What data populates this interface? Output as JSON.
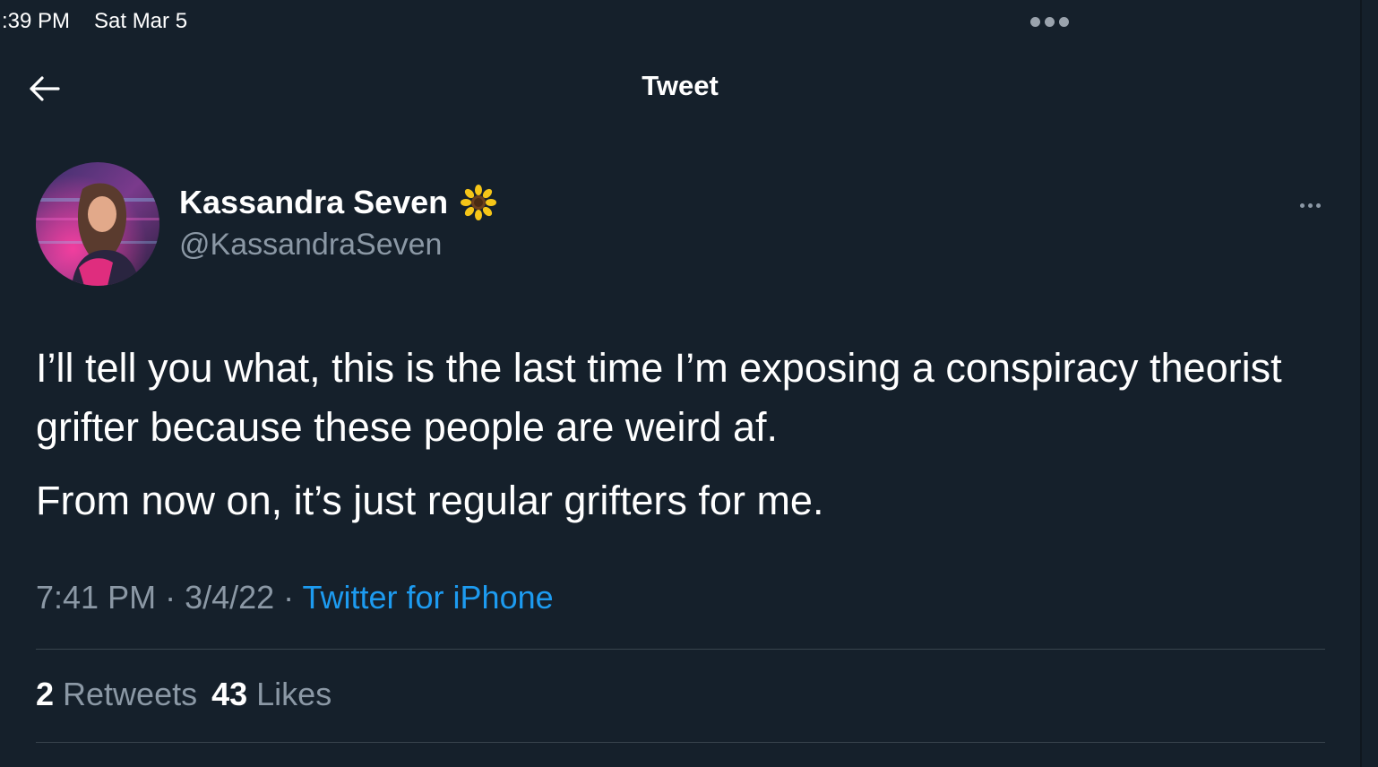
{
  "status_bar": {
    "time": ":39 PM",
    "date": "Sat Mar 5",
    "multitask_icon": "ellipsis-icon"
  },
  "header": {
    "title": "Tweet",
    "back_icon": "back-arrow-icon"
  },
  "tweet": {
    "author": {
      "display_name": "Kassandra Seven",
      "badge_emoji": "🌻",
      "handle": "@KassandraSeven"
    },
    "more_icon": "more-options-icon",
    "text": {
      "paragraph_1": "I’ll tell you what, this is the last time I’m exposing a conspiracy theorist grifter because these people are weird af.",
      "paragraph_2": "From now on, it’s just regular grifters for me."
    },
    "meta": {
      "time": "7:41 PM",
      "separator": " · ",
      "date": "3/4/22",
      "source": "Twitter for iPhone"
    },
    "stats": {
      "retweets_count": "2",
      "retweets_label": "Retweets",
      "likes_count": "43",
      "likes_label": "Likes"
    }
  },
  "colors": {
    "background": "#15202b",
    "text_primary": "#ffffff",
    "text_secondary": "#8b98a5",
    "accent": "#1d9bf0",
    "divider": "#38444d"
  }
}
